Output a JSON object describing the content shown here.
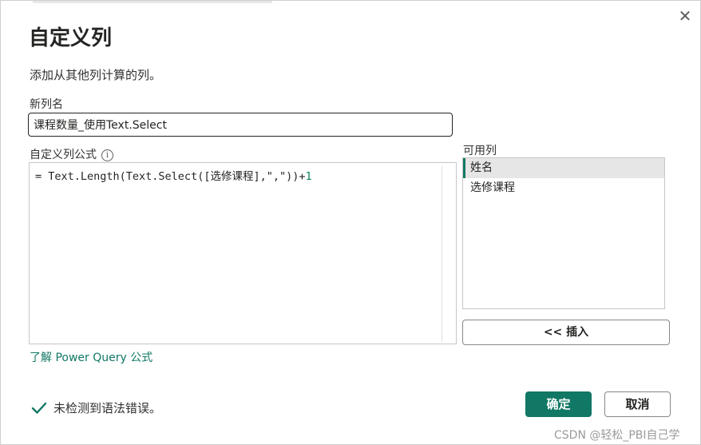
{
  "dialog": {
    "title": "自定义列",
    "subtitle": "添加从其他列计算的列。",
    "close_icon": "close-icon"
  },
  "new_column": {
    "label": "新列名",
    "value": "课程数量_使用Text.Select"
  },
  "formula": {
    "label": "自定义列公式",
    "info_icon": "info-icon",
    "code_prefix": "= Text.Length(Text.Select([选修课程],\",\"))+",
    "code_number": "1"
  },
  "available_columns": {
    "label": "可用列",
    "items": [
      {
        "label": "姓名",
        "selected": true
      },
      {
        "label": "选修课程",
        "selected": false
      }
    ],
    "insert_button": "<< 插入"
  },
  "learn_link": "了解 Power Query 公式",
  "status": {
    "text": "未检测到语法错误。",
    "icon": "checkmark-icon",
    "color": "#117865"
  },
  "buttons": {
    "ok": "确定",
    "cancel": "取消"
  },
  "watermark": "CSDN @轻松_PBI自己学",
  "colors": {
    "accent": "#117865"
  }
}
